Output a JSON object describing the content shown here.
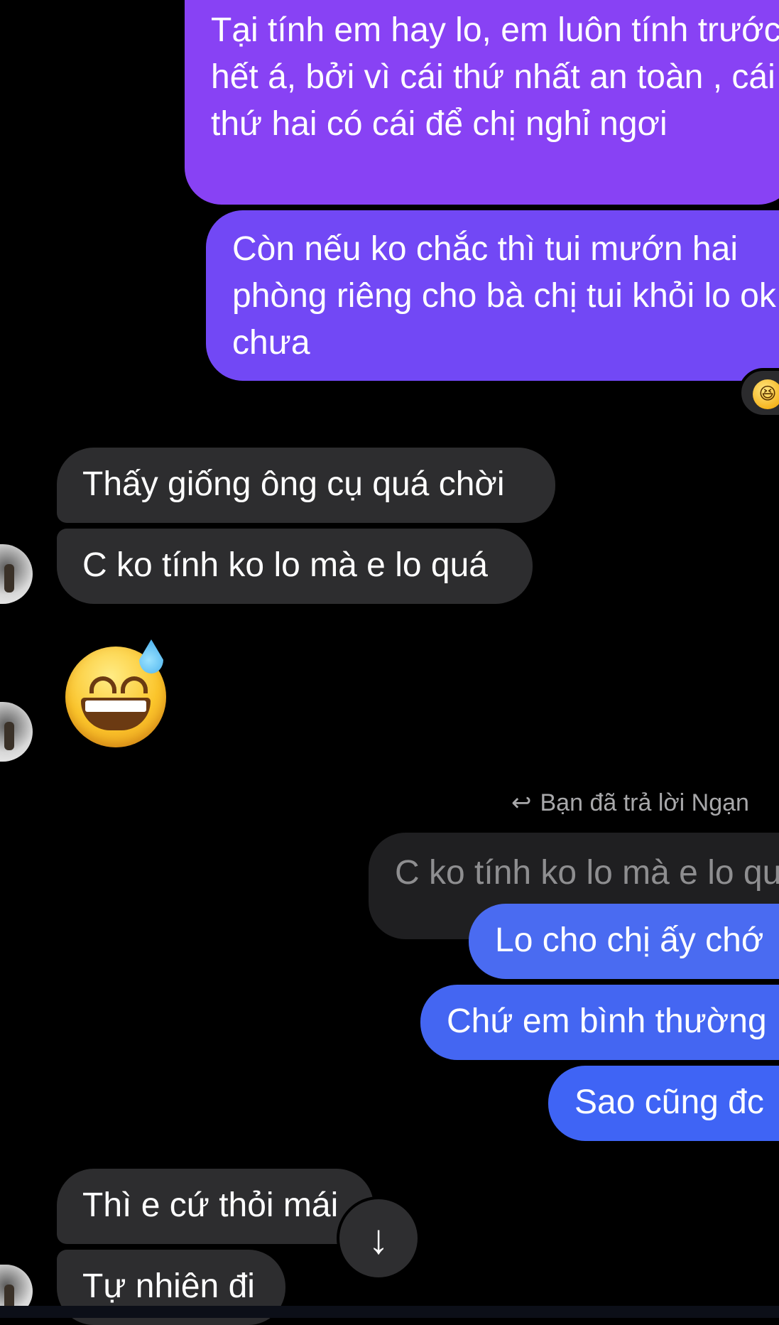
{
  "messages": {
    "out_1": "Tại tính em hay lo, em luôn tính trước hết á, bởi vì cái thứ nhất an toàn , cái thứ hai có cái để chị nghỉ ngơi",
    "out_2": "Còn nếu ko chắc thì tui mướn hai phòng riêng cho bà chị tui khỏi lo ok chưa",
    "reaction_emoji": "😆",
    "in_1": "Thấy giống ông cụ quá chời",
    "in_2": "C ko tính ko lo mà e lo quá",
    "in_emoji": "😅",
    "reply_note": "Bạn đã trả lời Ngạn",
    "quoted": "C ko tính ko lo mà e lo quá",
    "out_3": "Lo cho chị ấy chớ",
    "out_4": "Chứ em bình thường",
    "out_5": "Sao cũng đc",
    "in_3": "Thì e cứ thỏi mái",
    "in_4": "Tự nhiên đi"
  },
  "icons": {
    "reply_arrow": "reply-arrow-icon",
    "scroll_down": "arrow-down-icon"
  },
  "colors": {
    "background": "#000000",
    "outgoing_purple": "#8842f4",
    "outgoing_blue": "#4466f2",
    "incoming_gray": "#2d2d2f"
  }
}
